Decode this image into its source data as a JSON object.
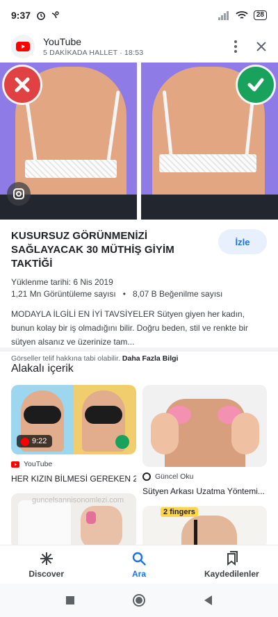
{
  "status_bar": {
    "time": "9:37",
    "battery": "28"
  },
  "header": {
    "title": "YouTube",
    "subtitle": "5 DAKİKADA HALLET · 18:53"
  },
  "video": {
    "title": "KUSURSUZ GÖRÜNMENİZİ SAĞLAYACAK 30 MÜTHİŞ GİYİM TAKTİĞİ",
    "watch_label": "İzle",
    "upload_date": "Yüklenme tarihi: 6 Nis 2019",
    "views": "1,21 Mn Görüntüleme sayısı",
    "stat_separator": "•",
    "likes": "8,07 B Beğenilme sayısı",
    "description": "MODAYLA İLGİLİ EN İYİ TAVSİYELER Sütyen giyen her kadın, bunun kolay bir iş olmadığını bilir. Doğru beden, stil ve renkte bir sütyen alsanız ve üzerinize tam...",
    "copyright_text": "Görseller telif hakkına tabi olabilir.",
    "more_info": "Daha Fazla Bilgi"
  },
  "related": {
    "title": "Alakalı içerik",
    "cards": [
      {
        "duration": "9:22",
        "source": "YouTube",
        "title": "HER KIZIN BİLMESİ GEREKEN 2..."
      },
      {
        "source": "Güncel Oku",
        "title": "Sütyen Arkası Uzatma Yöntemi..."
      },
      {
        "watermark": "guncelsannisonomlezi.com"
      },
      {
        "overlay_text": "2 fingers"
      }
    ]
  },
  "bottom_nav": {
    "items": [
      {
        "label": "Discover",
        "icon": "asterisk-icon"
      },
      {
        "label": "Ara",
        "icon": "search-icon",
        "active": true
      },
      {
        "label": "Kaydedilenler",
        "icon": "bookmarks-icon"
      }
    ]
  },
  "colors": {
    "accent": "#1a73e8",
    "youtube_red": "#ff0000",
    "x_red": "#e04243",
    "check_green": "#18a25c"
  }
}
